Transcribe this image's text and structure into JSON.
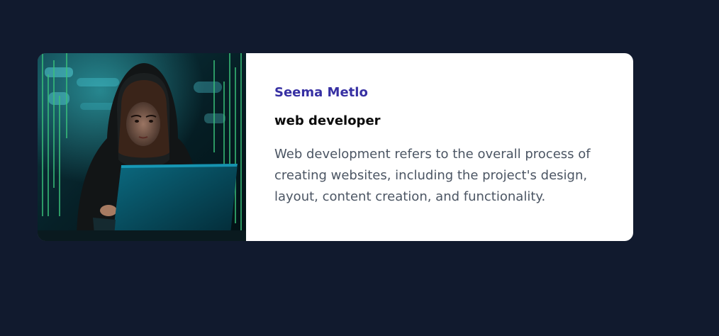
{
  "profile_card": {
    "image_icon": "hooded-developer-with-laptop",
    "name": "Seema Metlo",
    "role": "web developer",
    "description": "Web development refers to the overall process of creating websites, including the project's design, layout, content creation, and functionality."
  },
  "colors": {
    "page_background": "#111a2e",
    "card_background": "#ffffff",
    "name_color": "#3730a3",
    "role_color": "#0b0b0b",
    "description_color": "#4b5563"
  }
}
